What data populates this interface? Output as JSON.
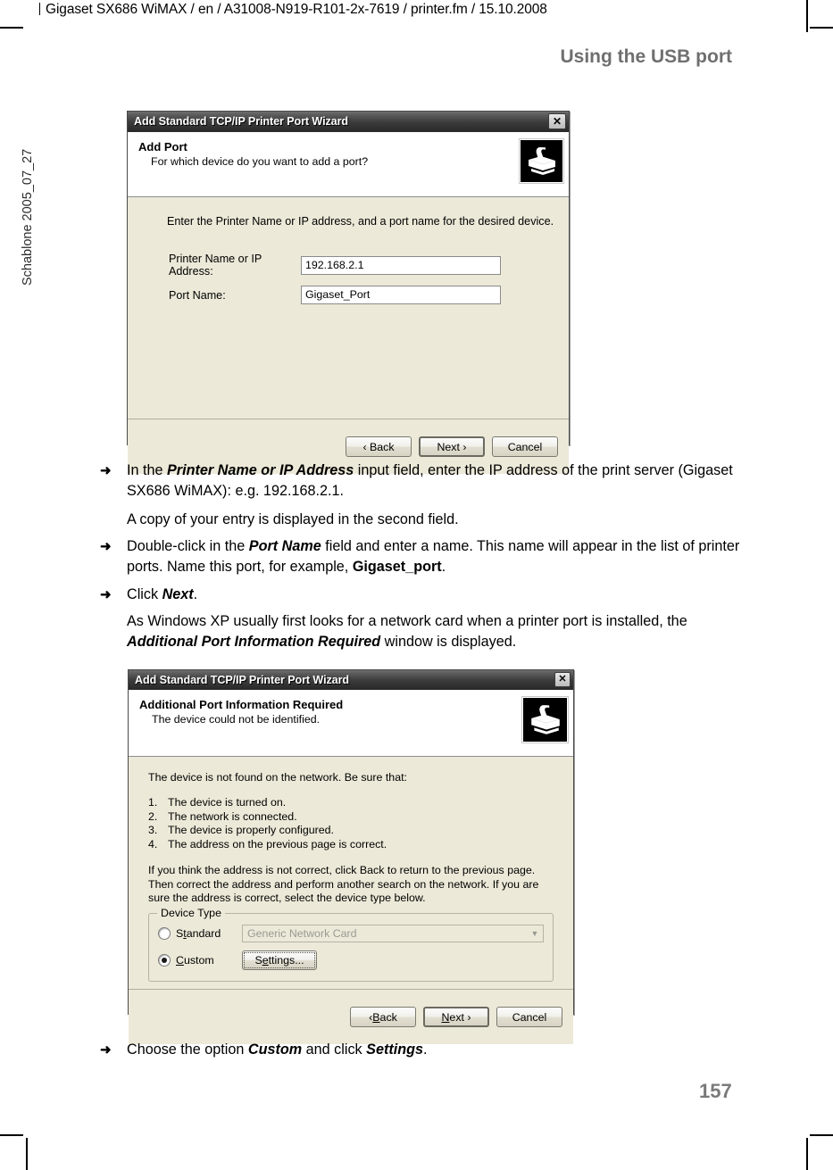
{
  "page": {
    "running_head": "Gigaset SX686 WiMAX / en / A31008-N919-R101-2x-7619 / printer.fm / 15.10.2008",
    "chapter_title": "Using the USB port",
    "side_label": "Schablone 2005_07_27",
    "page_number": "157"
  },
  "dialog1": {
    "title": "Add Standard TCP/IP Printer Port Wizard",
    "close_label": "✕",
    "header_title": "Add Port",
    "header_sub": "For which device do you want to add a port?",
    "instruction": "Enter the Printer Name or IP address, and a port name for the desired device.",
    "fields": [
      {
        "label": "Printer Name or IP Address:",
        "value": "192.168.2.1"
      },
      {
        "label": "Port Name:",
        "value": "Gigaset_Port"
      }
    ],
    "buttons": {
      "back": "‹ Back",
      "next": "Next ›",
      "cancel": "Cancel"
    }
  },
  "dialog2": {
    "title": "Add Standard TCP/IP Printer Port Wizard",
    "close_label": "✕",
    "header_title": "Additional Port Information Required",
    "header_sub": "The device could not be identified.",
    "intro": "The device is not found on the network.  Be sure that:",
    "checklist": [
      {
        "num": "1.",
        "text": "The device is turned on."
      },
      {
        "num": "2.",
        "text": "The network is connected."
      },
      {
        "num": "3.",
        "text": "The device is properly configured."
      },
      {
        "num": "4.",
        "text": "The address on the previous page is correct."
      }
    ],
    "note": "If you think the address is not correct, click Back to return to the previous page.  Then correct the address and perform another search on the network.  If you are sure the address is correct, select the device type below.",
    "groupbox": {
      "legend": "Device Type",
      "standard_label_pre": "S",
      "standard_label_key": "t",
      "standard_label_post": "andard",
      "standard_value": "Generic Network Card",
      "custom_label_pre": "",
      "custom_label_key": "C",
      "custom_label_post": "ustom",
      "settings_pre": "S",
      "settings_key": "e",
      "settings_post": "ttings...",
      "selected": "Custom"
    },
    "buttons": {
      "back_pre": "‹ ",
      "back_key": "B",
      "back_post": "ack",
      "next_key": "N",
      "next_post": "ext ›",
      "cancel": "Cancel"
    }
  },
  "body_text": {
    "step1_a": "In the ",
    "step1_b": "Printer Name or IP Address",
    "step1_c": " input field, enter the IP address of the print server (Gigaset SX686 WiMAX): e.g. 192.168.2.1.",
    "note1": "A copy of your entry is displayed in the second field.",
    "step2_a": "Double-click in the ",
    "step2_b": "Port Name",
    "step2_c": " field and enter a name. This name will appear in the list of printer ports. Name this port, for example, ",
    "step2_d": "Gigaset_port",
    "step2_e": ".",
    "step3_a": "Click ",
    "step3_b": "Next",
    "step3_c": ".",
    "note2_a": "As Windows XP usually first looks for a network card when a printer port is installed, the ",
    "note2_b": "Additional Port Information Required",
    "note2_c": " window is displayed.",
    "step4_a": "Choose the option ",
    "step4_b": "Custom",
    "step4_c": " and click ",
    "step4_d": "Settings",
    "step4_e": ".",
    "arrow": "➜"
  }
}
